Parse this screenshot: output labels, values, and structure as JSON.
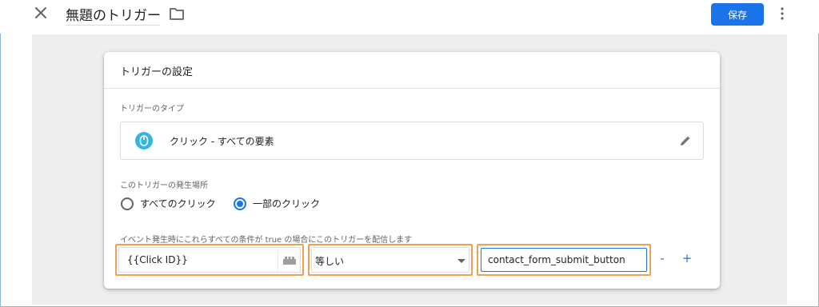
{
  "header": {
    "title": "無題のトリガー",
    "save_label": "保存",
    "icons": {
      "close": "close-icon",
      "folder": "folder-icon",
      "more": "more-vert-icon"
    }
  },
  "card": {
    "title": "トリガーの設定",
    "trigger_type_label": "トリガーのタイプ",
    "trigger_type_value": "クリック - すべての要素",
    "fires_on_label": "このトリガーの発生場所",
    "radio_options": [
      {
        "label": "すべてのクリック",
        "checked": false
      },
      {
        "label": "一部のクリック",
        "checked": true
      }
    ],
    "condition_label": "イベント発生時にこれらすべての条件が true の場合にこのトリガーを配信します",
    "condition": {
      "variable": "{{Click ID}}",
      "operator": "等しい",
      "value": "contact_form_submit_button",
      "remove_label": "-",
      "add_label": "+"
    }
  },
  "colors": {
    "accent": "#1a73e8",
    "highlight": "#f0a050",
    "trigger_icon": "#33b6e5",
    "canvas_bg": "#eeeeee"
  }
}
